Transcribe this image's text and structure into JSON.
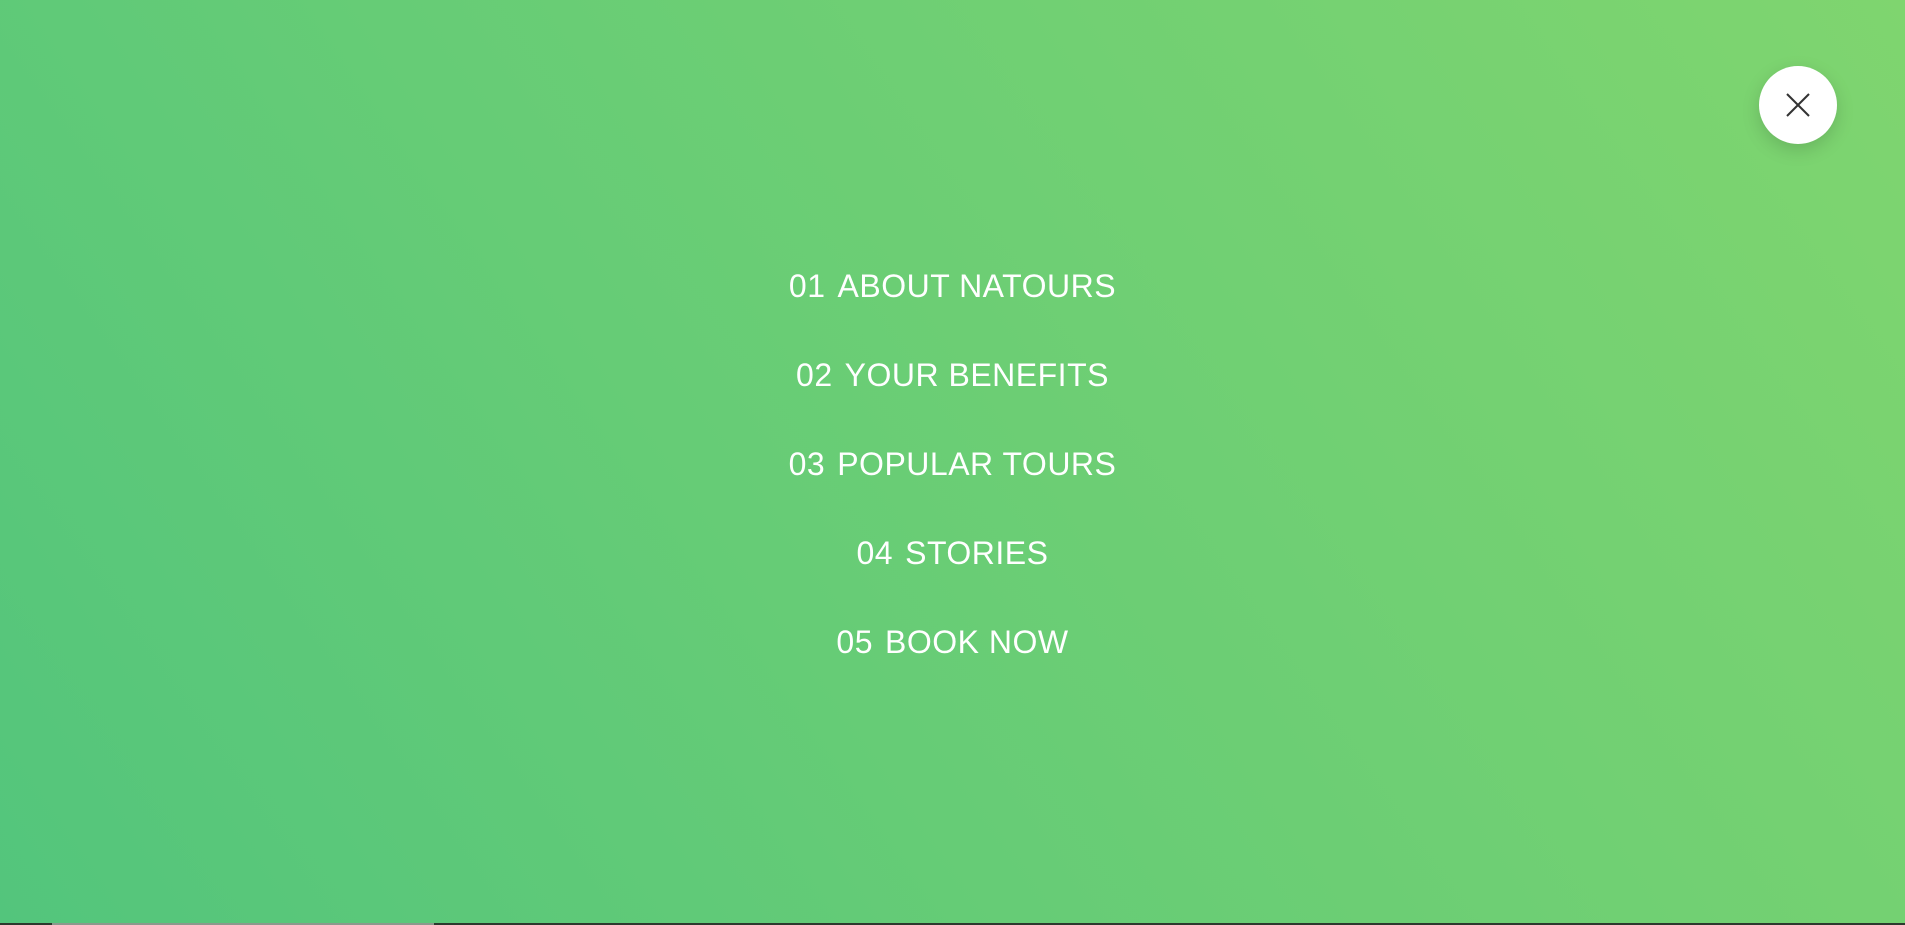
{
  "colors": {
    "gradient_start": "#53c57c",
    "gradient_end": "#7fd56f",
    "text": "#ffffff",
    "close_button_bg": "#ffffff"
  },
  "close": {
    "icon": "close-icon"
  },
  "nav": {
    "items": [
      {
        "number": "01",
        "label": "ABOUT NATOURS"
      },
      {
        "number": "02",
        "label": "YOUR BENEFITS"
      },
      {
        "number": "03",
        "label": "POPULAR TOURS"
      },
      {
        "number": "04",
        "label": "STORIES"
      },
      {
        "number": "05",
        "label": "BOOK NOW"
      }
    ]
  }
}
